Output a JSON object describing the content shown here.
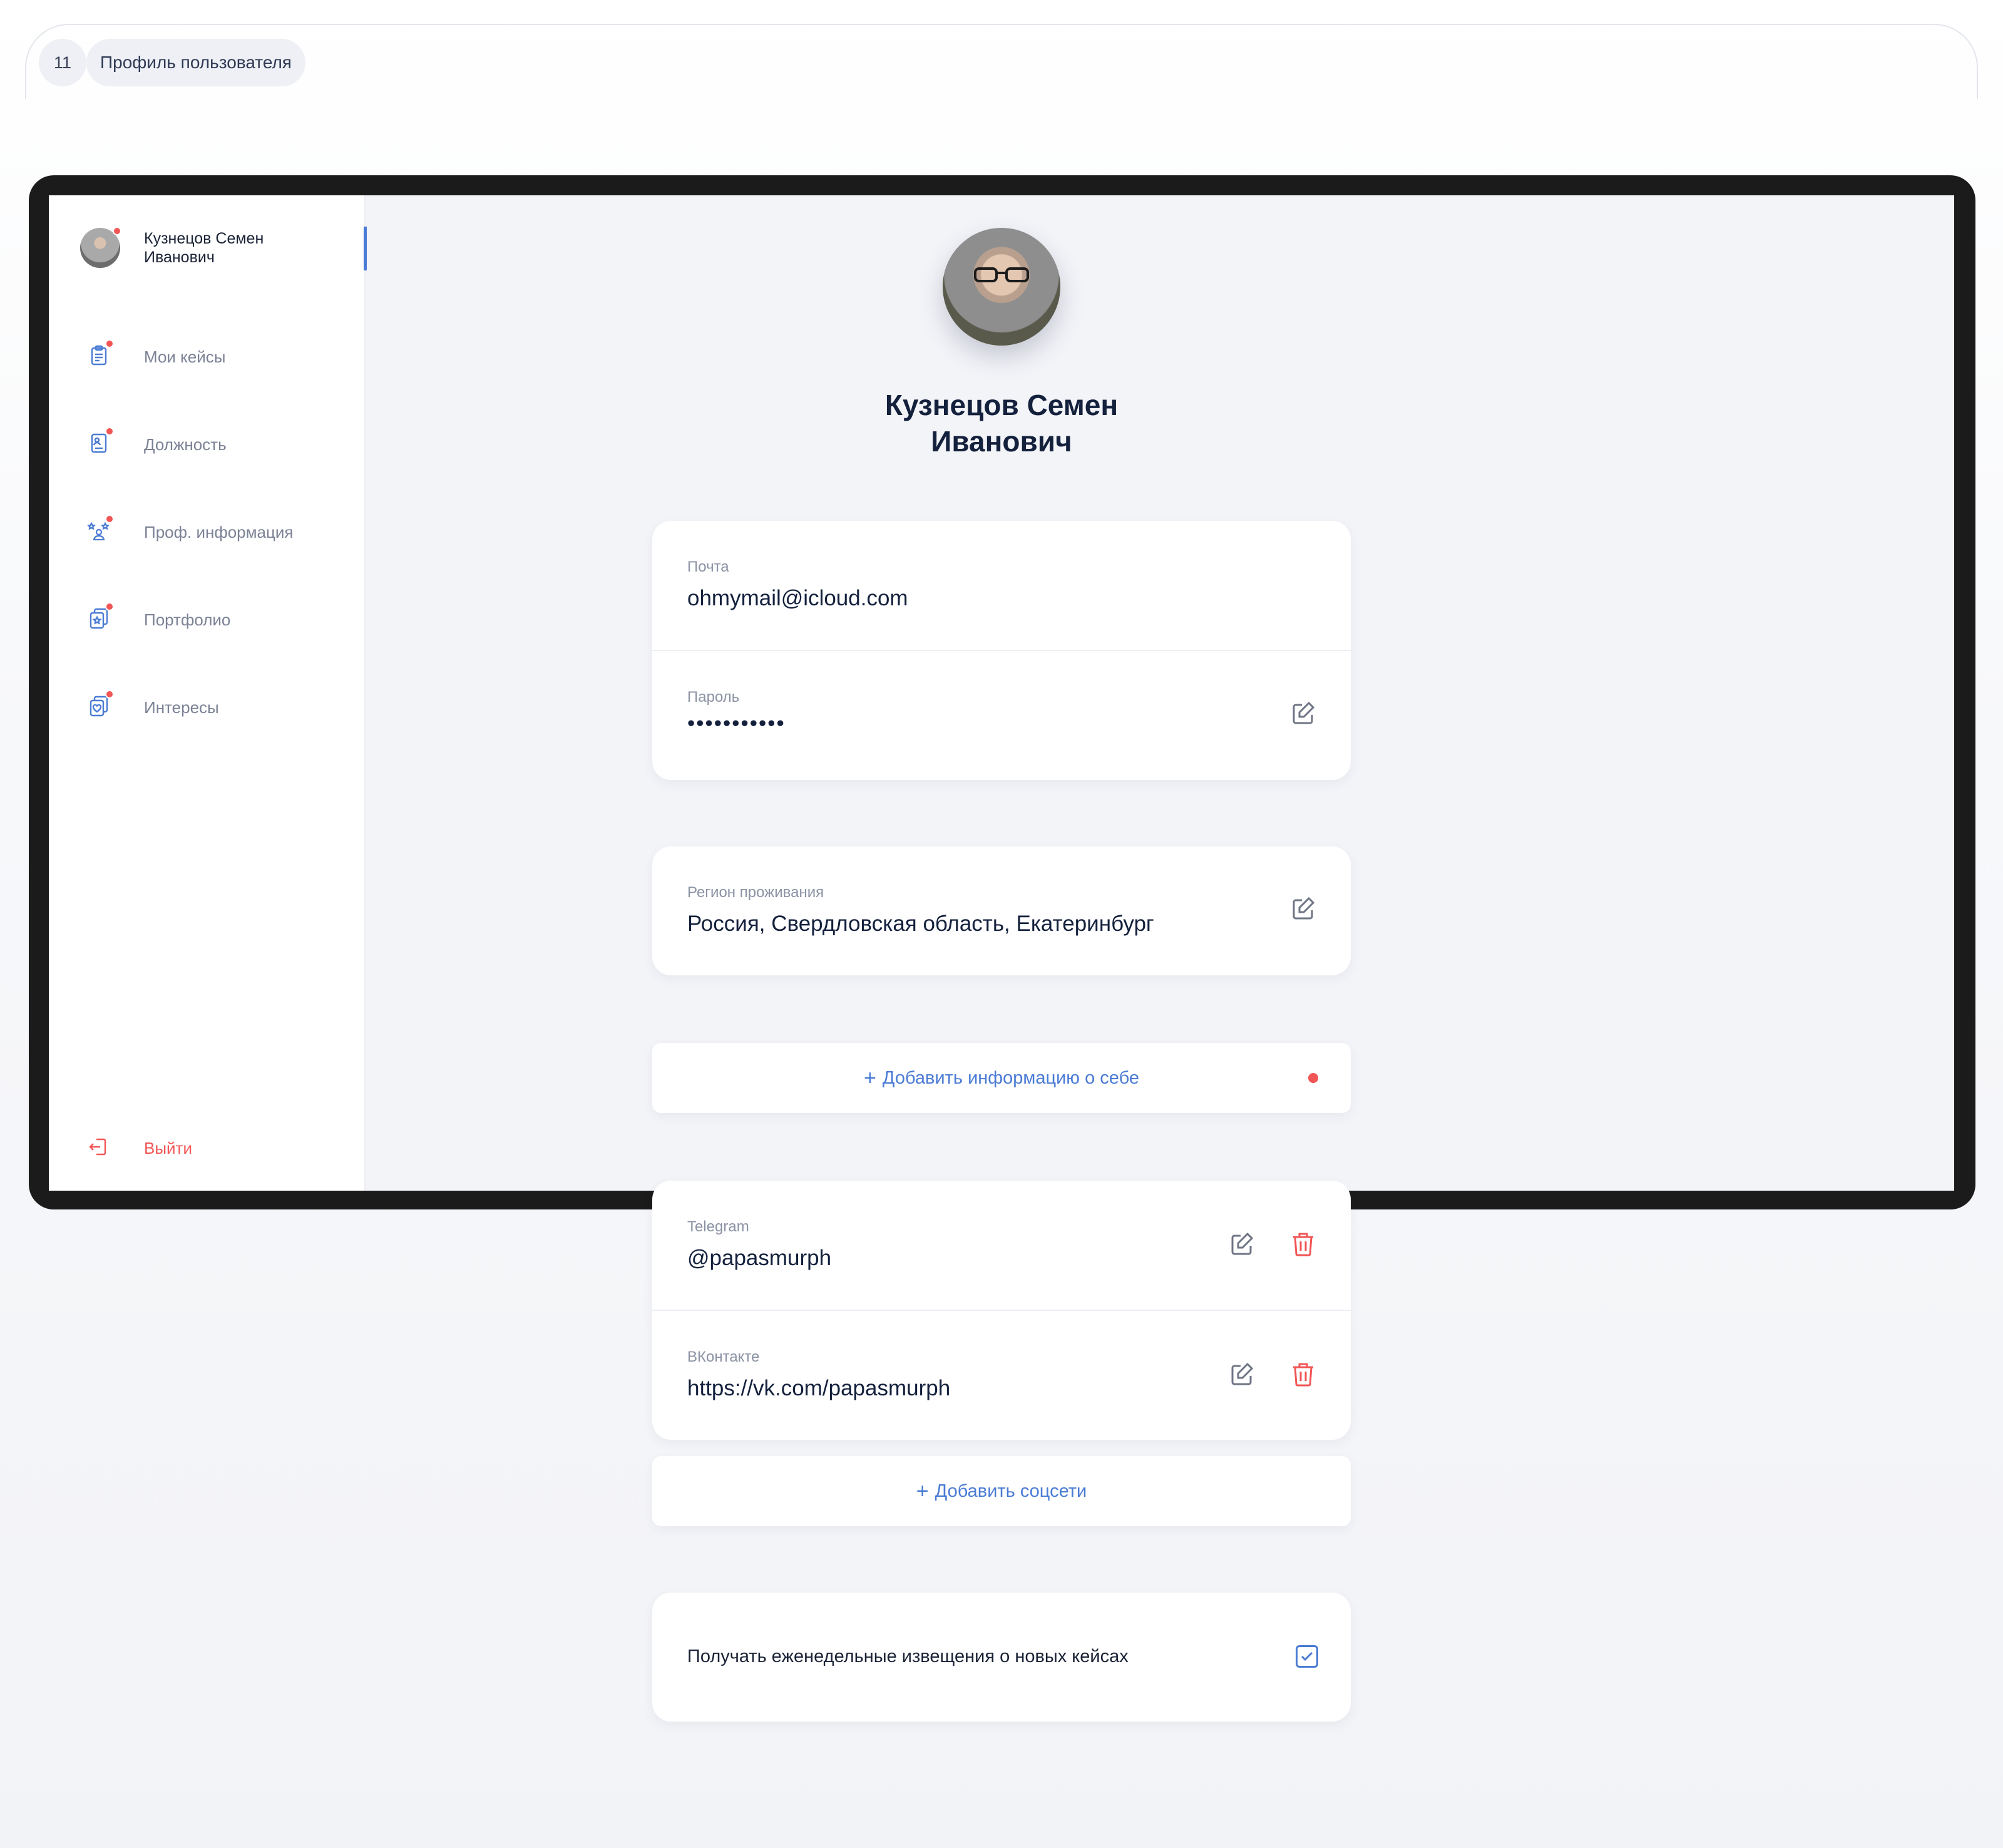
{
  "step": {
    "number": "11",
    "title": "Профиль пользователя"
  },
  "sidebar": {
    "user_name": "Кузнецов Семен Иванович",
    "items": [
      {
        "label": "Мои кейсы",
        "icon": "cases-icon"
      },
      {
        "label": "Должность",
        "icon": "position-icon"
      },
      {
        "label": "Проф. информация",
        "icon": "prof-info-icon"
      },
      {
        "label": "Портфолио",
        "icon": "portfolio-icon"
      },
      {
        "label": "Интересы",
        "icon": "interests-icon"
      }
    ],
    "logout_label": "Выйти"
  },
  "profile": {
    "name": "Кузнецов Семен Иванович",
    "email_label": "Почта",
    "email_value": "ohmymail@icloud.com",
    "password_label": "Пароль",
    "password_value": "•••••••••••",
    "region_label": "Регион проживания",
    "region_value": "Россия, Свердловская область, Екатеринбург",
    "add_info_label": "Добавить информацию о себе",
    "socials": [
      {
        "label": "Telegram",
        "value": "@papasmurph"
      },
      {
        "label": "ВКонтакте",
        "value": "https://vk.com/papasmurph"
      }
    ],
    "add_social_label": "Добавить соцсети",
    "notify_label": "Получать еженедельные извещения о новых кейсах",
    "notify_checked": true
  },
  "colors": {
    "accent": "#4a7bd4",
    "danger": "#f25555",
    "text": "#14213d",
    "muted": "#8b92a4"
  }
}
